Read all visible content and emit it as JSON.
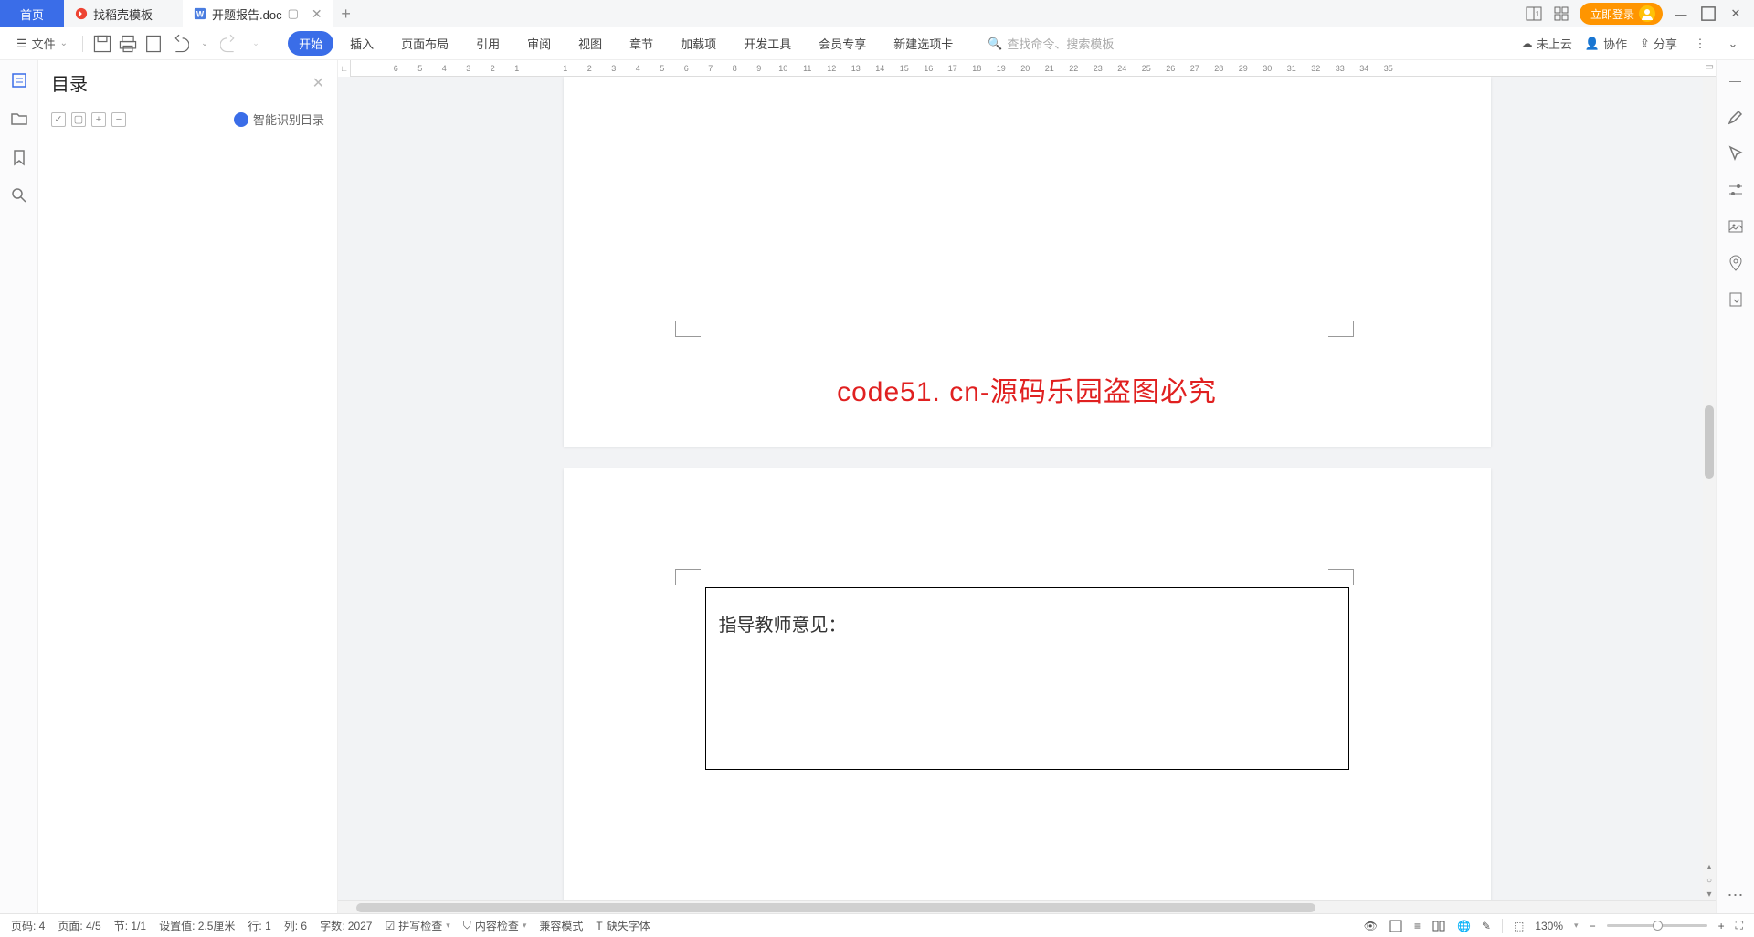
{
  "tabs": {
    "home": "首页",
    "templates": "找稻壳模板",
    "document": "开题报告.doc"
  },
  "titlebar": {
    "login": "立即登录"
  },
  "menubar": {
    "file": "文件",
    "ribbons": [
      "开始",
      "插入",
      "页面布局",
      "引用",
      "审阅",
      "视图",
      "章节",
      "加载项",
      "开发工具",
      "会员专享",
      "新建选项卡"
    ],
    "search_placeholder": "查找命令、搜索模板",
    "cloud": "未上云",
    "collab": "协作",
    "share": "分享"
  },
  "toc": {
    "title": "目录",
    "smart": "智能识别目录"
  },
  "ruler": [
    "6",
    "5",
    "4",
    "3",
    "2",
    "1",
    "",
    "1",
    "2",
    "3",
    "4",
    "5",
    "6",
    "7",
    "8",
    "9",
    "10",
    "11",
    "12",
    "13",
    "14",
    "15",
    "16",
    "17",
    "18",
    "19",
    "20",
    "21",
    "22",
    "23",
    "24",
    "25",
    "26",
    "27",
    "28",
    "29",
    "30",
    "31",
    "32",
    "33",
    "34",
    "35"
  ],
  "document": {
    "watermark": "code51. cn-源码乐园盗图必究",
    "section_label": "指导教师意见："
  },
  "status": {
    "page_code": "页码: 4",
    "page": "页面: 4/5",
    "section": "节: 1/1",
    "setting": "设置值: 2.5厘米",
    "row": "行: 1",
    "col": "列: 6",
    "words": "字数: 2027",
    "spellcheck": "拼写检查",
    "content_check": "内容检查",
    "compat": "兼容模式",
    "missing_font": "缺失字体",
    "zoom": "130%"
  }
}
